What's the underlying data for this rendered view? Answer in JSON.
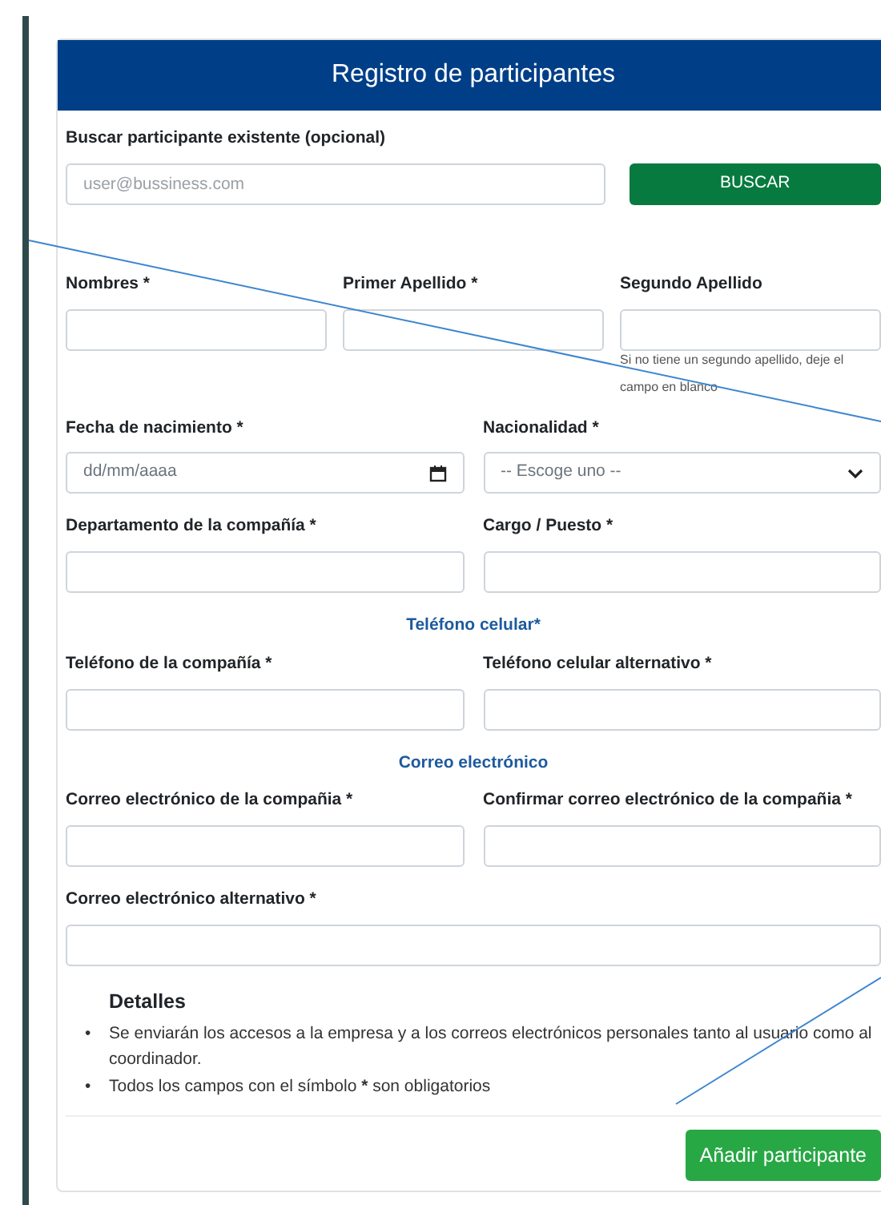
{
  "title": "Registro de participantes",
  "search": {
    "label": "Buscar participante existente (opcional)",
    "placeholder": "user@bussiness.com",
    "button": "BUSCAR"
  },
  "rows": [
    {
      "kind": "fields",
      "fields": [
        {
          "label": "Nombres *",
          "kind": "text"
        },
        {
          "label": "Primer Apellido *",
          "kind": "text"
        },
        {
          "label": "Segundo Apellido",
          "kind": "text",
          "hint": "Si no tiene un segundo apellido, deje el campo en blanco"
        }
      ]
    },
    {
      "kind": "fields",
      "fields": [
        {
          "label": "Fecha de nacimiento *",
          "kind": "date",
          "placeholder": "dd/mm/aaaa"
        },
        {
          "label": "Nacionalidad *",
          "kind": "select",
          "placeholder": "-- Escoge uno --"
        }
      ]
    },
    {
      "kind": "fields",
      "fields": [
        {
          "label": "Departamento de la compañía *",
          "kind": "text"
        },
        {
          "label": "Cargo / Puesto *",
          "kind": "text"
        }
      ]
    },
    {
      "kind": "heading",
      "text": "Teléfono celular*"
    },
    {
      "kind": "fields",
      "fields": [
        {
          "label": "Teléfono de la compañía *",
          "kind": "text"
        },
        {
          "label": "Teléfono celular alternativo *",
          "kind": "text"
        }
      ]
    },
    {
      "kind": "heading",
      "text": "Correo electrónico"
    },
    {
      "kind": "fields",
      "fields": [
        {
          "label": "Correo electrónico de la compañia *",
          "kind": "text"
        },
        {
          "label": "Confirmar correo electrónico de la compañia *",
          "kind": "text"
        }
      ]
    },
    {
      "kind": "fields",
      "fields": [
        {
          "label": "Correo electrónico alternativo *",
          "kind": "text"
        }
      ]
    }
  ],
  "details": {
    "title": "Detalles",
    "items": [
      {
        "marker": "•",
        "segments": [
          {
            "text": "Se enviarán los accesos a la empresa y a los correos electrónicos personales tanto al usuario como al coordinador.",
            "bold": false
          }
        ]
      },
      {
        "marker": "•",
        "segments": [
          {
            "text": "Todos los campos con el símbolo ",
            "bold": false
          },
          {
            "text": "*",
            "bold": true
          },
          {
            "text": " son obligatorios",
            "bold": false
          }
        ]
      }
    ]
  },
  "submit": "Añadir participante"
}
